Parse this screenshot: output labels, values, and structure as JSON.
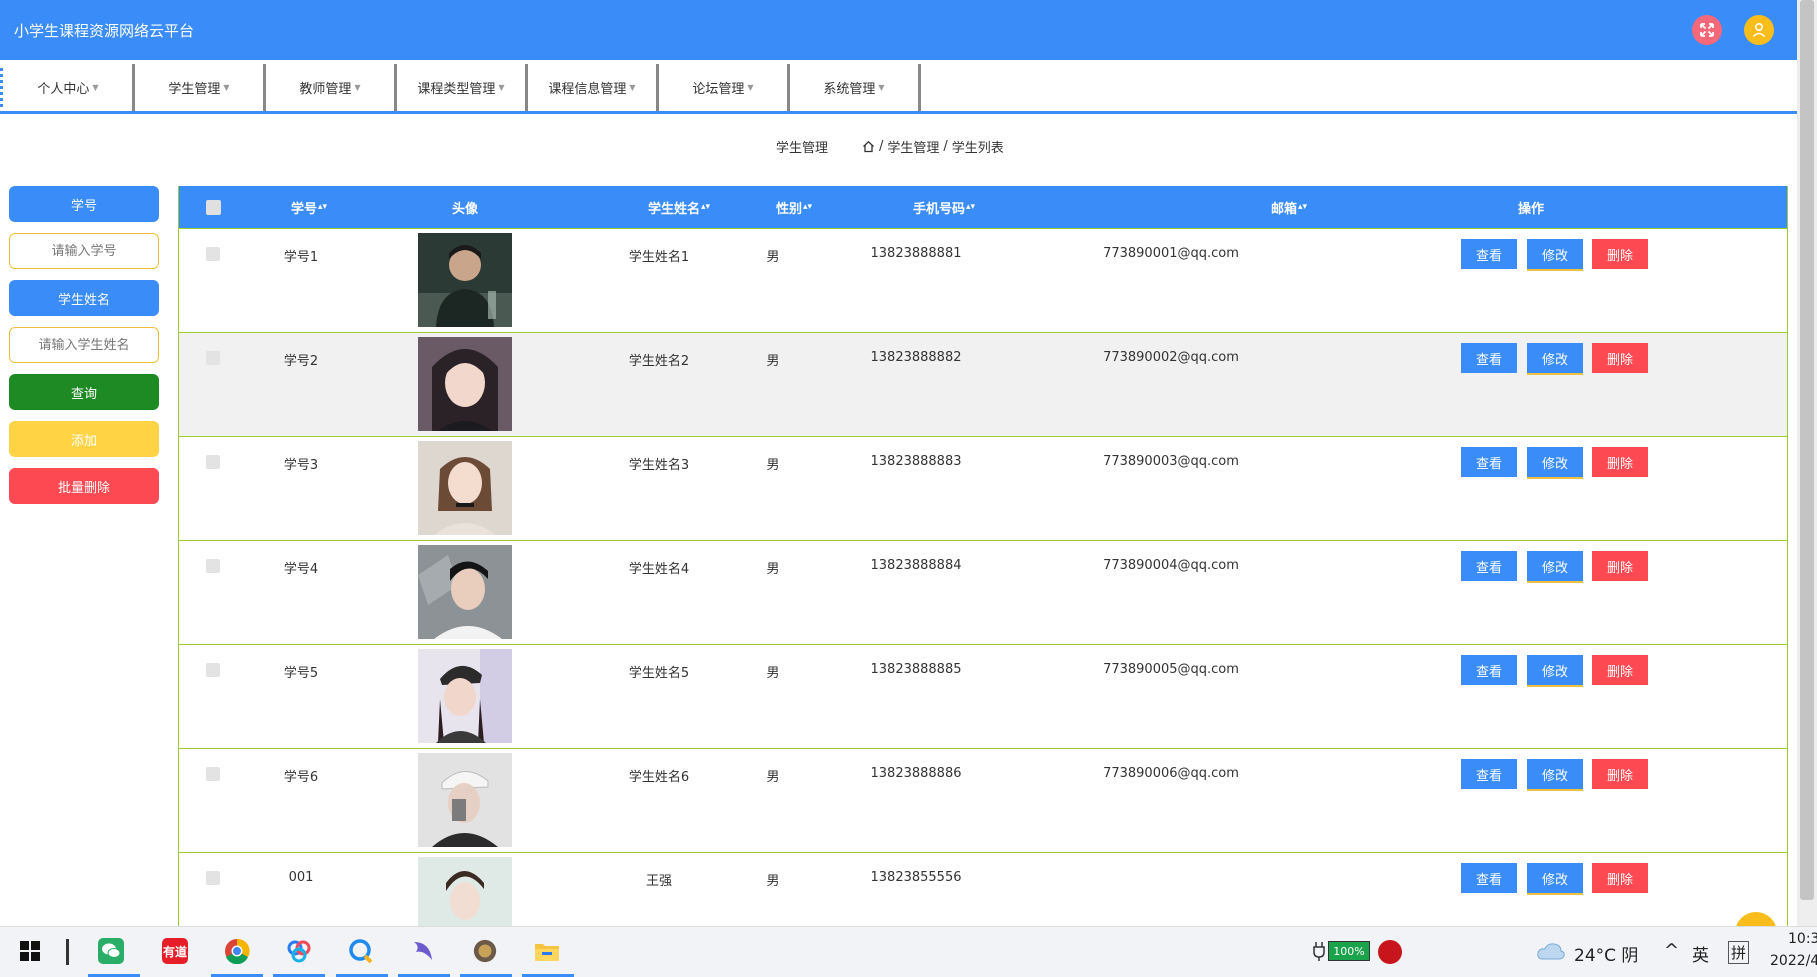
{
  "app": {
    "title": "小学生课程资源网络云平台"
  },
  "topbar": {
    "fullscreen_icon": "expand-icon",
    "user_icon": "user-icon"
  },
  "nav": {
    "items": [
      {
        "label": "个人中心"
      },
      {
        "label": "学生管理"
      },
      {
        "label": "教师管理"
      },
      {
        "label": "课程类型管理"
      },
      {
        "label": "课程信息管理"
      },
      {
        "label": "论坛管理"
      },
      {
        "label": "系统管理"
      }
    ]
  },
  "breadcrumb": {
    "page_title": "学生管理",
    "sep": "/",
    "level1": "学生管理",
    "level2": "学生列表"
  },
  "search": {
    "id_label": "学号",
    "id_placeholder": "请输入学号",
    "name_label": "学生姓名",
    "name_placeholder": "请输入学生姓名",
    "query_button": "查询",
    "add_button": "添加",
    "batch_delete_button": "批量删除"
  },
  "table": {
    "headers": {
      "id": "学号",
      "avatar": "头像",
      "name": "学生姓名",
      "gender": "性别",
      "phone": "手机号码",
      "email": "邮箱",
      "actions": "操作"
    },
    "sort_icon": "▴▾",
    "rows": [
      {
        "id": "学号1",
        "name": "学生姓名1",
        "gender": "男",
        "phone": "13823888881",
        "email": "773890001@qq.com"
      },
      {
        "id": "学号2",
        "name": "学生姓名2",
        "gender": "男",
        "phone": "13823888882",
        "email": "773890002@qq.com"
      },
      {
        "id": "学号3",
        "name": "学生姓名3",
        "gender": "男",
        "phone": "13823888883",
        "email": "773890003@qq.com"
      },
      {
        "id": "学号4",
        "name": "学生姓名4",
        "gender": "男",
        "phone": "13823888884",
        "email": "773890004@qq.com"
      },
      {
        "id": "学号5",
        "name": "学生姓名5",
        "gender": "男",
        "phone": "13823888885",
        "email": "773890005@qq.com"
      },
      {
        "id": "学号6",
        "name": "学生姓名6",
        "gender": "男",
        "phone": "13823888886",
        "email": "773890006@qq.com"
      },
      {
        "id": "001",
        "name": "王强",
        "gender": "男",
        "phone": "13823855556",
        "email": ""
      }
    ],
    "action_labels": {
      "view": "查看",
      "edit": "修改",
      "delete": "删除"
    }
  },
  "taskbar": {
    "apps": [
      {
        "icon": "windows-start-icon"
      },
      {
        "icon": "wechat-icon"
      },
      {
        "icon": "youdao-icon",
        "label": "有道"
      },
      {
        "icon": "chrome-icon"
      },
      {
        "icon": "baidu-netdisk-icon"
      },
      {
        "icon": "qq-browser-icon"
      },
      {
        "icon": "dolphin-icon"
      },
      {
        "icon": "game-icon"
      },
      {
        "icon": "file-explorer-icon"
      }
    ],
    "battery": "100%",
    "weather": "24°C 阴",
    "ime_lang": "英",
    "ime_mode": "拼",
    "time": "10:3",
    "date": "2022/4"
  },
  "colors": {
    "primary": "#3a8cf9",
    "success": "#1e8a23",
    "warning": "#ffd344",
    "danger": "#fd4a52",
    "row_border": "#9acd32"
  }
}
